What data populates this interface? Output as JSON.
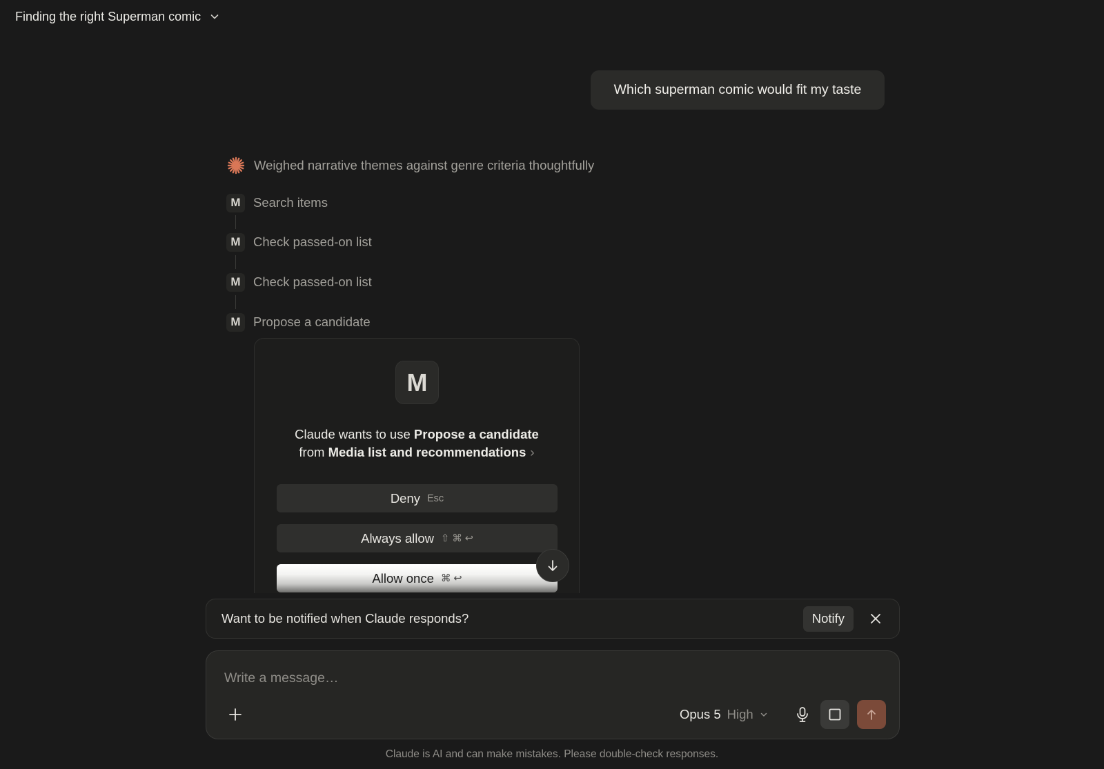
{
  "header": {
    "title": "Finding the right Superman comic",
    "title_icon": "chevron-down-icon"
  },
  "conversation": {
    "user_message": "Which superman comic would fit my taste",
    "thinking": {
      "icon": "claude-spark-icon",
      "text": "Weighed narrative themes against genre criteria thoughtfully"
    },
    "steps": [
      {
        "badge": "M",
        "label": "Search items"
      },
      {
        "badge": "M",
        "label": "Check passed-on list"
      },
      {
        "badge": "M",
        "label": "Check passed-on list"
      },
      {
        "badge": "M",
        "label": "Propose a candidate"
      }
    ]
  },
  "permission": {
    "icon_letter": "M",
    "line1_prefix": "Claude wants to use ",
    "tool_name": "Propose a candidate",
    "line2_prefix": "from ",
    "server_name": "Media list and recommendations",
    "deny_label": "Deny",
    "deny_shortcut": "Esc",
    "always_label": "Always allow",
    "always_shortcut": "⇧ ⌘ ↩",
    "once_label": "Allow once",
    "once_shortcut": "⌘ ↩"
  },
  "notify": {
    "text": "Want to be notified when Claude responds?",
    "button_label": "Notify"
  },
  "composer": {
    "placeholder": "Write a message…",
    "model": "Opus 5",
    "effort": "High"
  },
  "footer": {
    "disclaimer": "Claude is AI and can make mistakes. Please double-check responses."
  },
  "colors": {
    "background": "#1a1a1a",
    "accent": "#d97757",
    "send_button": "#7b4a39"
  }
}
